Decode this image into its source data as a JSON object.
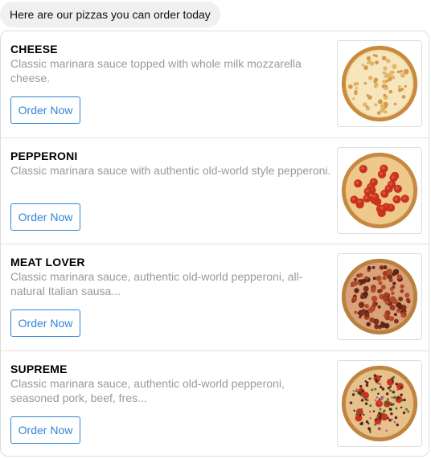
{
  "chat": {
    "message": "Here are our pizzas you can order today"
  },
  "pizzas": [
    {
      "title": "CHEESE",
      "description": "Classic marinara sauce topped with whole milk mozzarella cheese.",
      "button_label": "Order Now",
      "image_icon": "cheese-pizza-image"
    },
    {
      "title": "PEPPERONI",
      "description": "Classic marinara sauce with authentic old-world style pepperoni.",
      "button_label": "Order Now",
      "image_icon": "pepperoni-pizza-image"
    },
    {
      "title": "MEAT LOVER",
      "description": "Classic marinara sauce, authentic old-world pepperoni, all-natural Italian sausa...",
      "button_label": "Order Now",
      "image_icon": "meat-lover-pizza-image"
    },
    {
      "title": "SUPREME",
      "description": "Classic marinara sauce, authentic old-world pepperoni, seasoned pork, beef, fres...",
      "button_label": "Order Now",
      "image_icon": "supreme-pizza-image"
    }
  ],
  "colors": {
    "accent": "#2f86d6",
    "description_text": "#999999",
    "bubble_bg": "#f0f0f0"
  }
}
